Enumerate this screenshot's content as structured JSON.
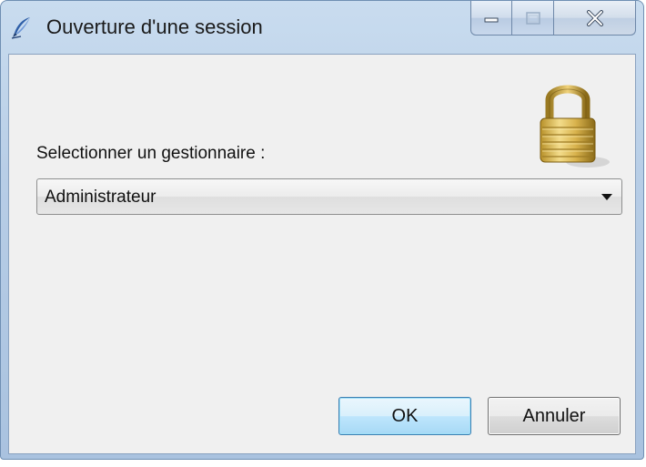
{
  "window": {
    "title": "Ouverture d'une session",
    "icons": {
      "app": "feather-pen-icon",
      "minimize": "minimize-icon",
      "maximize": "maximize-icon",
      "close": "close-icon"
    }
  },
  "form": {
    "label": "Selectionner un gestionnaire :",
    "selected_manager": "Administrateur",
    "lock_icon": "padlock-icon"
  },
  "buttons": {
    "ok_label": "OK",
    "cancel_label": "Annuler"
  },
  "colors": {
    "frame": "#b7cde6",
    "client_background": "#f0f0f0",
    "ok_border": "#3c7fb1"
  }
}
